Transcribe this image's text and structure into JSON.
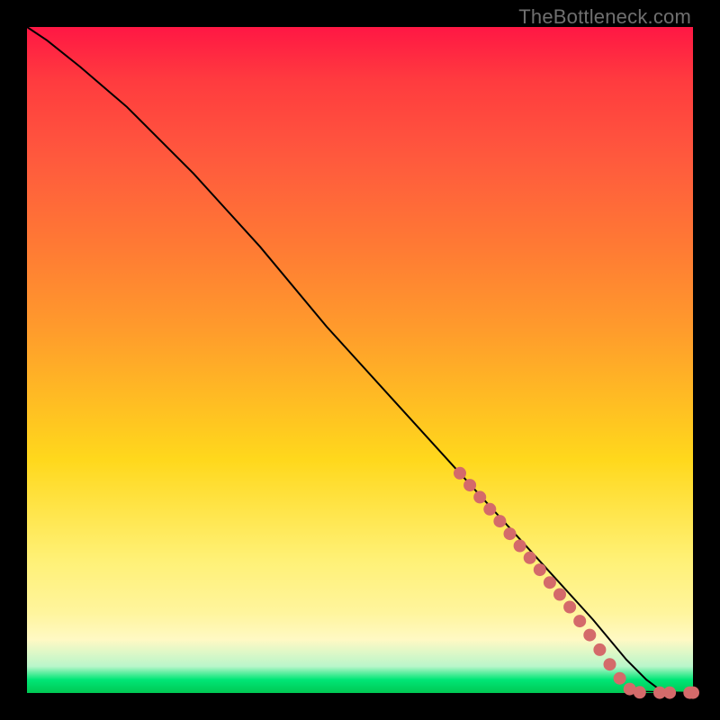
{
  "watermark": "TheBottleneck.com",
  "colors": {
    "dot": "#d46a6a",
    "line": "#000000"
  },
  "chart_data": {
    "type": "line",
    "title": "",
    "xlabel": "",
    "ylabel": "",
    "xlim": [
      0,
      100
    ],
    "ylim": [
      0,
      100
    ],
    "grid": false,
    "series": [
      {
        "name": "curve",
        "x": [
          0,
          3,
          8,
          15,
          25,
          35,
          45,
          55,
          65,
          75,
          85,
          90,
          93,
          95,
          97,
          99,
          100
        ],
        "y": [
          100,
          98,
          94,
          88,
          78,
          67,
          55,
          44,
          33,
          22,
          11,
          5,
          2,
          0.5,
          0.1,
          0,
          0
        ]
      }
    ],
    "markers": [
      {
        "x": 65,
        "y": 33,
        "r": 7
      },
      {
        "x": 66.5,
        "y": 31.2,
        "r": 7
      },
      {
        "x": 68,
        "y": 29.4,
        "r": 7
      },
      {
        "x": 69.5,
        "y": 27.6,
        "r": 7
      },
      {
        "x": 71,
        "y": 25.8,
        "r": 7
      },
      {
        "x": 72.5,
        "y": 23.9,
        "r": 7
      },
      {
        "x": 74,
        "y": 22.1,
        "r": 7
      },
      {
        "x": 75.5,
        "y": 20.3,
        "r": 7
      },
      {
        "x": 77,
        "y": 18.5,
        "r": 7
      },
      {
        "x": 78.5,
        "y": 16.6,
        "r": 7
      },
      {
        "x": 80,
        "y": 14.8,
        "r": 7
      },
      {
        "x": 81.5,
        "y": 12.9,
        "r": 7
      },
      {
        "x": 83,
        "y": 10.8,
        "r": 7
      },
      {
        "x": 84.5,
        "y": 8.7,
        "r": 7
      },
      {
        "x": 86,
        "y": 6.5,
        "r": 7
      },
      {
        "x": 87.5,
        "y": 4.3,
        "r": 7
      },
      {
        "x": 89,
        "y": 2.2,
        "r": 7
      },
      {
        "x": 90.5,
        "y": 0.6,
        "r": 7
      },
      {
        "x": 92,
        "y": 0.1,
        "r": 7
      },
      {
        "x": 95,
        "y": 0.05,
        "r": 7
      },
      {
        "x": 96.5,
        "y": 0.05,
        "r": 7
      },
      {
        "x": 99.5,
        "y": 0.05,
        "r": 7
      },
      {
        "x": 100,
        "y": 0.05,
        "r": 7
      }
    ]
  }
}
